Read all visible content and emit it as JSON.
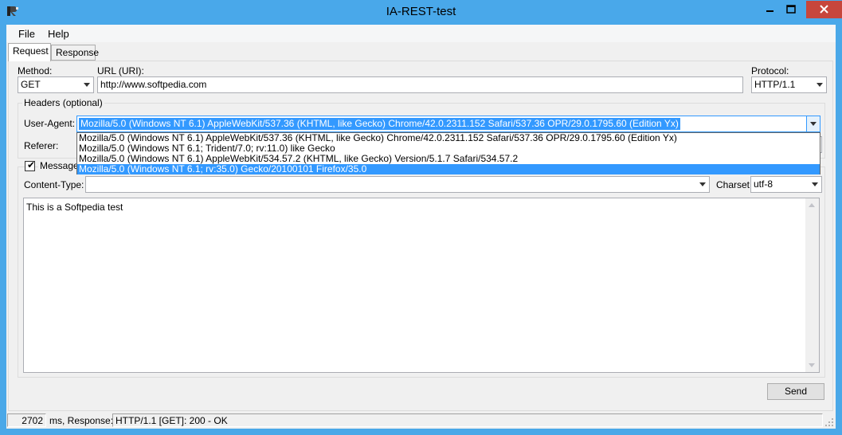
{
  "window": {
    "title": "IA-REST-test"
  },
  "menu": [
    "File",
    "Help"
  ],
  "tabs": [
    "Request",
    "Response"
  ],
  "request": {
    "method_label": "Method:",
    "method_value": "GET",
    "url_label": "URL (URI):",
    "url_value": "http://www.softpedia.com",
    "protocol_label": "Protocol:",
    "protocol_value": "HTTP/1.1"
  },
  "headers": {
    "group_title": "Headers (optional)",
    "user_agent_label": "User-Agent:",
    "user_agent_value": "Mozilla/5.0 (Windows NT 6.1) AppleWebKit/537.36 (KHTML, like Gecko) Chrome/42.0.2311.152 Safari/537.36 OPR/29.0.1795.60 (Edition Yx)",
    "user_agent_options": [
      "Mozilla/5.0 (Windows NT 6.1) AppleWebKit/537.36 (KHTML, like Gecko) Chrome/42.0.2311.152 Safari/537.36 OPR/29.0.1795.60 (Edition Yx)",
      "Mozilla/5.0 (Windows NT 6.1; Trident/7.0; rv:11.0) like Gecko",
      "Mozilla/5.0 (Windows NT 6.1) AppleWebKit/534.57.2 (KHTML, like Gecko) Version/5.1.7 Safari/534.57.2",
      "Mozilla/5.0 (Windows NT 6.1; rv:35.0) Gecko/20100101 Firefox/35.0"
    ],
    "referer_label": "Referer:"
  },
  "message": {
    "checkbox_label": "Message b",
    "content_type_label": "Content-Type:",
    "content_type_value": "",
    "charset_label": "Charset:",
    "charset_value": "utf-8",
    "body": "This is a Softpedia test"
  },
  "send_label": "Send",
  "status": {
    "elapsed": "2702",
    "text_label": "ms, Response:",
    "response": "HTTP/1.1 [GET]: 200 - OK"
  },
  "colors": {
    "titlebar": "#49a8ea",
    "close": "#c7463c",
    "selection": "#3399ff"
  },
  "icons": [
    "app-icon",
    "minimize-icon",
    "maximize-icon",
    "close-icon",
    "chevron-down-icon",
    "checkmark-icon",
    "size-grip-icon"
  ]
}
